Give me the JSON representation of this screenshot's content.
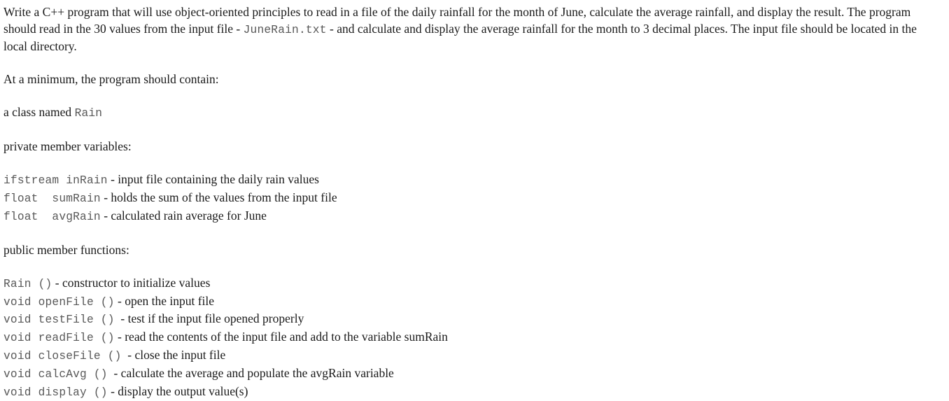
{
  "document": {
    "intro": {
      "seg1": "Write a C++ program that will use object-oriented principles to read in a file of the daily rainfall for the month of June, calculate the average rainfall, and display the result.  The program should read in the 30 values from the input file - ",
      "file_name": "JuneRain.txt",
      "seg2": " - and calculate and display the average rainfall for the month to 3 decimal places.  The input file should be located in the local directory."
    },
    "minimum_heading": "At a minimum, the program should contain:",
    "class_line": {
      "prefix": "a class named ",
      "class_name": "Rain"
    },
    "private_heading": "private member variables:",
    "private_members": [
      {
        "code": "ifstream inRain",
        "desc": " - input file containing the daily rain values"
      },
      {
        "code": "float  sumRain",
        "desc": " - holds the sum of the values from the input file"
      },
      {
        "code": "float  avgRain",
        "desc": " - calculated rain average for June"
      }
    ],
    "public_heading": "public member functions:",
    "public_members": [
      {
        "code": "Rain ()",
        "desc": " - constructor to initialize values"
      },
      {
        "code": "void openFile ()",
        "desc": " - open the input file"
      },
      {
        "code": "void testFile ()",
        "desc": "  - test if the input file opened properly"
      },
      {
        "code": "void readFile ()",
        "desc": " - read the contents of the input file and add to the variable sumRain"
      },
      {
        "code": "void closeFile ()",
        "desc": "  - close the input file"
      },
      {
        "code": "void calcAvg ()",
        "desc": "  - calculate the average and populate the avgRain variable"
      },
      {
        "code": "void display ()",
        "desc": " - display the output value(s)"
      }
    ]
  }
}
